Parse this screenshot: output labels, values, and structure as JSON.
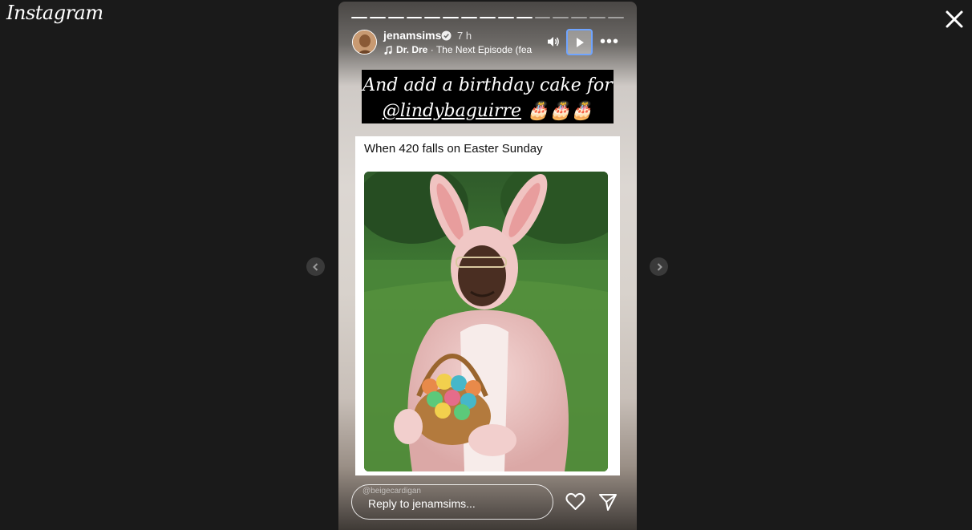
{
  "app": {
    "logo": "Instagram"
  },
  "story": {
    "progress": {
      "total_segments": 15,
      "completed_segments": 10
    },
    "username": "jenamsims",
    "time": "7 h",
    "music": {
      "artist": "Dr. Dre",
      "separator": " · ",
      "track": "The Next Episode (fea"
    },
    "caption": {
      "line1": "And add a birthday cake for",
      "mention": "@lindybaguirre",
      "emoji": "🎂🎂🎂"
    },
    "card": {
      "title": "When 420 falls on Easter Sunday"
    },
    "reply": {
      "tag": "@beigecardigan",
      "placeholder": "Reply to jenamsims..."
    }
  },
  "colors": {
    "background": "#1a1a1a",
    "play_focus_ring": "#6fa4ff",
    "caption_bg": "#000000"
  },
  "icons": [
    "close-icon",
    "chevron-left-icon",
    "chevron-right-icon",
    "verified-icon",
    "music-note-icon",
    "speaker-icon",
    "play-icon",
    "more-icon",
    "heart-icon",
    "share-icon"
  ]
}
